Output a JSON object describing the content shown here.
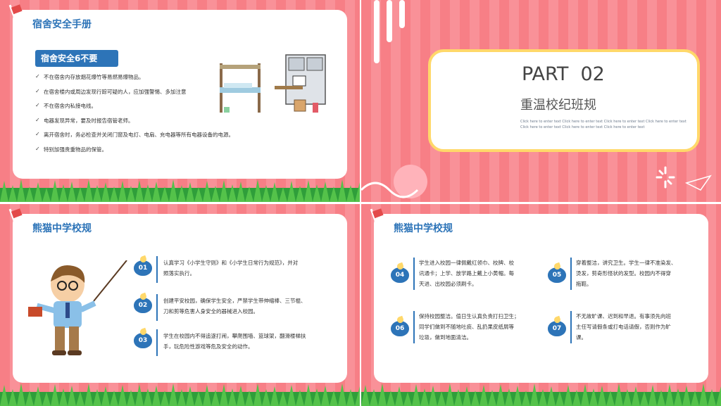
{
  "slide1": {
    "title": "宿舍安全手册",
    "badge": "宿舍安全6不要",
    "rules": [
      "不在宿舍内存放烟花爆竹等易燃易爆物品。",
      "在宿舍楼内或周边发现行踪可疑的人，应加强警惕、多加注意",
      "不在宿舍内私接电线。",
      "电器发现异常，要及时报告宿管老师。",
      "离开宿舍时，务必检查并关闭门窗及电灯、电扇、充电器等所有电器设备的电源。",
      "特别加强贵重物品的保管。"
    ]
  },
  "slide2": {
    "part": "PART  02",
    "subtitle": "重温校纪班规",
    "placeholder": "Click here to enter text   Click here to enter text   Click here to enter text   Click here to enter text   Click here to enter text   Click here to enter text   Click here to enter text"
  },
  "slide3": {
    "title": "熊猫中学校规",
    "items": [
      {
        "num": "01",
        "text1": "认真学习《小学生守则》和《小学生日常行为规范》，并对",
        "text2": "照落实执行。"
      },
      {
        "num": "02",
        "text1": "创建平安校园，确保学生安全，严禁学生带伸缩棒、三节棍、",
        "text2": "刀和剪等危害人身安全的器械进入校园。"
      },
      {
        "num": "03",
        "text1": "学生在校园内不得追逐打闹，攀爬围墙、篮球架，翻滑楼梯扶",
        "text2": "手，玩危险性游戏等危及安全的动作。"
      }
    ]
  },
  "slide4": {
    "title": "熊猫中学校规",
    "items": [
      {
        "num": "04",
        "lines": [
          "学生进入校园一律佩戴红领巾、校牌、校",
          "讯通卡；上学、放学路上戴上小黄帽。每",
          "天进、出校园必须刷卡。"
        ]
      },
      {
        "num": "05",
        "lines": [
          "穿着整洁，讲究卫生。学生一律不准染发、",
          "烫发，剪奇形怪状的发型。校园内不得穿",
          "拖鞋。"
        ]
      },
      {
        "num": "06",
        "lines": [
          "保持校园整洁。值日生认真负责打扫卫生；",
          "同学们做到不随地吐痰、乱扔果皮纸屑等",
          "垃圾，做到地面清洁。"
        ]
      },
      {
        "num": "07",
        "lines": [
          "不无故旷课、迟到和早退。有事须先向班",
          "主任写请假条或打电话请假，否则作为旷",
          "课。"
        ]
      }
    ]
  }
}
